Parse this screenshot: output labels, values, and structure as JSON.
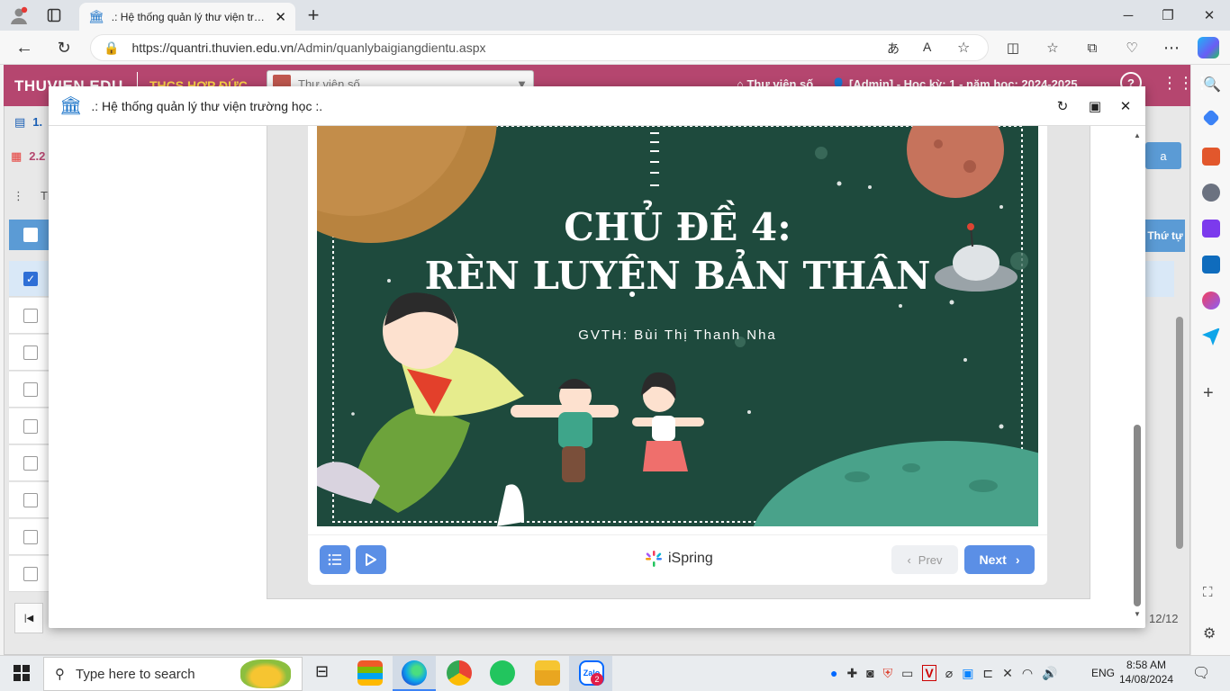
{
  "browser": {
    "tab_title": ".: Hệ thống quản lý thư viện trường học :.",
    "url_host": "https://quantri.thuvien.edu.vn",
    "url_path": "/Admin/quanlybaigiangdientu.aspx"
  },
  "site": {
    "brand": "THUVIEN.EDU",
    "school": "THCS HỢP ĐỨC",
    "library_select": "Thư viện số",
    "nav_library": "Thư viện số",
    "admin_info": "[Admin] - Học kỳ: 1 - năm học: 2024-2025",
    "left_rows": [
      "1.",
      "2.2",
      "Th"
    ],
    "col_order": "Thứ tự",
    "btn_partial": "a",
    "pager": "12/12"
  },
  "modal": {
    "title": ".: Hệ thống quản lý thư viện trường học :."
  },
  "slide": {
    "title_line1": "CHỦ ĐỀ 4:",
    "title_line2": "RÈN LUYỆN BẢN THÂN",
    "subtitle": "GVTH: Bùi Thị Thanh Nha"
  },
  "player": {
    "brand": "iSpring",
    "prev_label": "Prev",
    "next_label": "Next"
  },
  "taskbar": {
    "search_placeholder": "Type here to search",
    "badge_count": "2",
    "language": "ENG",
    "time": "8:58 AM",
    "date": "14/08/2024"
  },
  "colors": {
    "site_header": "#b5466f",
    "school_text": "#ffd54a",
    "player_button": "#5b8fe6",
    "slide_bg": "#1e4a3d"
  }
}
